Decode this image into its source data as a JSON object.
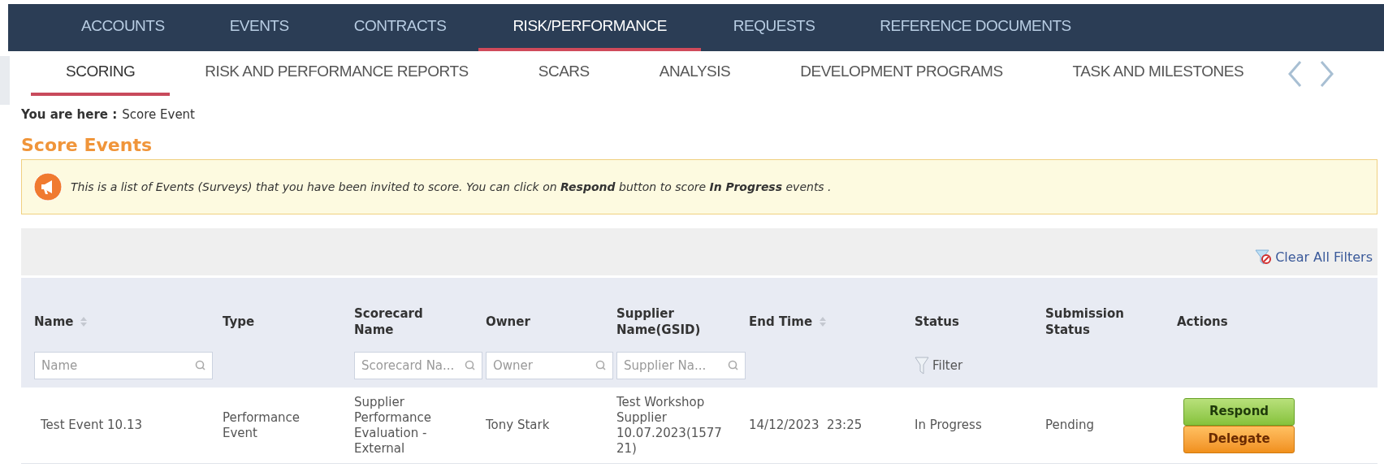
{
  "top_nav": [
    {
      "label": "ACCOUNTS",
      "selected": false
    },
    {
      "label": "EVENTS",
      "selected": false
    },
    {
      "label": "CONTRACTS",
      "selected": false
    },
    {
      "label": "RISK/PERFORMANCE",
      "selected": true
    },
    {
      "label": "REQUESTS",
      "selected": false
    },
    {
      "label": "REFERENCE DOCUMENTS",
      "selected": false
    }
  ],
  "sub_nav": [
    {
      "label": "SCORING",
      "selected": true
    },
    {
      "label": "RISK AND PERFORMANCE REPORTS",
      "selected": false
    },
    {
      "label": "SCARS",
      "selected": false
    },
    {
      "label": "ANALYSIS",
      "selected": false
    },
    {
      "label": "DEVELOPMENT PROGRAMS",
      "selected": false
    },
    {
      "label": "TASK AND MILESTONES",
      "selected": false
    }
  ],
  "breadcrumb": {
    "label": "You are here :",
    "current": "Score Event"
  },
  "heading": "Score Events",
  "info": "This is a list of Events (Surveys) that you have been invited to score. You can click on **Respond** button to score **In Progress** events .",
  "toolbar": {
    "clear_filters": "Clear All Filters"
  },
  "table": {
    "columns": [
      {
        "label": "Name",
        "sortable": true,
        "filter": {
          "kind": "search",
          "placeholder": "Name"
        }
      },
      {
        "label": "Type",
        "sortable": false
      },
      {
        "label": "Scorecard Name",
        "sortable": false,
        "filter": {
          "kind": "search",
          "placeholder": "Scorecard Na..."
        }
      },
      {
        "label": "Owner",
        "sortable": false,
        "filter": {
          "kind": "search",
          "placeholder": "Owner"
        }
      },
      {
        "label": "Supplier Name(GSID)",
        "sortable": false,
        "filter": {
          "kind": "search",
          "placeholder": "Supplier Na..."
        }
      },
      {
        "label": "End Time",
        "sortable": true
      },
      {
        "label": "Status",
        "sortable": false,
        "filter": {
          "kind": "menu",
          "label": "Filter"
        }
      },
      {
        "label": "Submission Status",
        "sortable": false
      },
      {
        "label": "Actions",
        "sortable": false
      }
    ],
    "rows": [
      {
        "cells": [
          "Test Event 10.13",
          "Performance Event",
          "Supplier Performance Evaluation -  External",
          "Tony Stark",
          "Test Workshop Supplier 10.07.2023(157721)",
          "14/12/2023  23:25",
          "In Progress",
          "Pending"
        ],
        "actions": [
          {
            "label": "Respond",
            "kind": "respond"
          },
          {
            "label": "Delegate",
            "kind": "delegate"
          }
        ]
      }
    ]
  }
}
